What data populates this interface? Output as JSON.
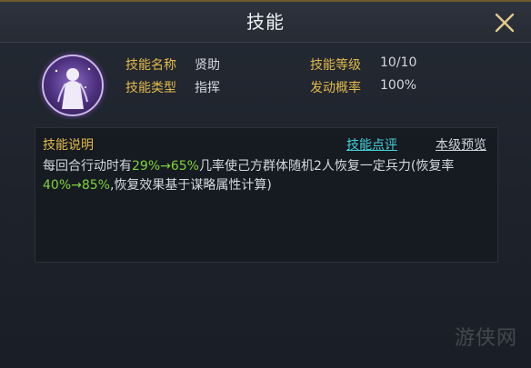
{
  "window": {
    "title": "技能"
  },
  "skill": {
    "name_label": "技能名称",
    "name_value": "贤助",
    "type_label": "技能类型",
    "type_value": "指挥",
    "level_label": "技能等级",
    "level_value": "10/10",
    "chance_label": "发动概率",
    "chance_value": "100%"
  },
  "description": {
    "title": "技能说明",
    "comment_link": "技能点评",
    "preview_link": "本级预览",
    "text": {
      "p1": "每回合行动时有",
      "h1": "29%→65%",
      "p2": "几率使己方群体随机2人恢复一定兵力(恢复率",
      "h2": "40%→85%",
      "p3": ",恢复效果基于谋略属性计算)"
    }
  },
  "watermark": "游侠网",
  "colors": {
    "accent_gold": "#e2b94a",
    "highlight_green": "#7fd33b",
    "link_cyan": "#41d1d8"
  },
  "icons": {
    "close": "close-icon",
    "avatar": "skill-portrait-icon"
  }
}
